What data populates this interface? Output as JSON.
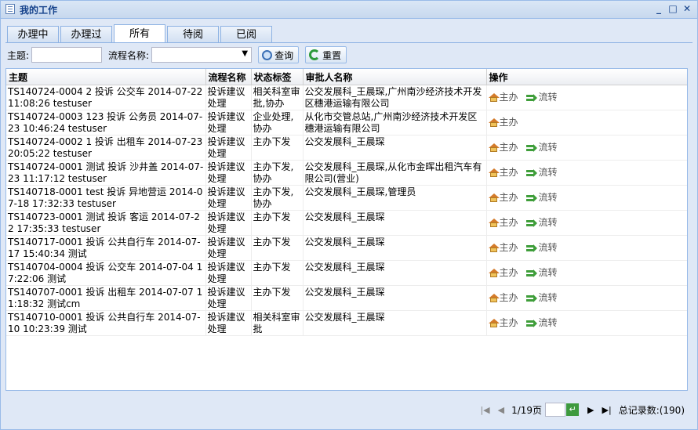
{
  "window": {
    "title": "我的工作"
  },
  "tabs": [
    {
      "label": "办理中",
      "active": false
    },
    {
      "label": "办理过",
      "active": false
    },
    {
      "label": "所有",
      "active": true
    },
    {
      "label": "待阅",
      "active": false
    },
    {
      "label": "已阅",
      "active": false
    }
  ],
  "filter": {
    "subject_label": "主题:",
    "process_label": "流程名称:",
    "query_button": "查询",
    "reset_button": "重置"
  },
  "table": {
    "columns": [
      "主题",
      "流程名称",
      "状态标签",
      "审批人名称",
      "操作"
    ],
    "rows": [
      {
        "subject": "TS140724-0004 2 投诉 公交车 2014-07-22 11:08:26 testuser",
        "process": "投诉建议处理",
        "status": "相关科室审批,协办",
        "approver": "公交发展科_王晨琛,广州南沙经济技术开发区穗港运输有限公司",
        "actions": [
          "主办",
          "流转"
        ]
      },
      {
        "subject": "TS140724-0003 123 投诉 公务员 2014-07-23 10:46:24 testuser",
        "process": "投诉建议处理",
        "status": "企业处理,协办",
        "approver": "从化市交管总站,广州南沙经济技术开发区穗港运输有限公司",
        "actions": [
          "主办"
        ]
      },
      {
        "subject": "TS140724-0002 1 投诉 出租车 2014-07-23 20:05:22 testuser",
        "process": "投诉建议处理",
        "status": "主办下发",
        "approver": "公交发展科_王晨琛",
        "actions": [
          "主办",
          "流转"
        ]
      },
      {
        "subject": "TS140724-0001 测试 投诉 沙井盖 2014-07-23 11:17:12 testuser",
        "process": "投诉建议处理",
        "status": "主办下发,协办",
        "approver": "公交发展科_王晨琛,从化市金晖出租汽车有限公司(营业)",
        "actions": [
          "主办",
          "流转"
        ]
      },
      {
        "subject": "TS140718-0001 test 投诉 异地营运 2014-07-18 17:32:33 testuser",
        "process": "投诉建议处理",
        "status": "主办下发,协办",
        "approver": "公交发展科_王晨琛,管理员",
        "actions": [
          "主办",
          "流转"
        ]
      },
      {
        "subject": "TS140723-0001 测试 投诉 客运 2014-07-22 17:35:33 testuser",
        "process": "投诉建议处理",
        "status": "主办下发",
        "approver": "公交发展科_王晨琛",
        "actions": [
          "主办",
          "流转"
        ]
      },
      {
        "subject": "TS140717-0001 投诉 公共自行车 2014-07-17 15:40:34 测试",
        "process": "投诉建议处理",
        "status": "主办下发",
        "approver": "公交发展科_王晨琛",
        "actions": [
          "主办",
          "流转"
        ]
      },
      {
        "subject": "TS140704-0004 投诉 公交车 2014-07-04 17:22:06 测试",
        "process": "投诉建议处理",
        "status": "主办下发",
        "approver": "公交发展科_王晨琛",
        "actions": [
          "主办",
          "流转"
        ]
      },
      {
        "subject": "TS140707-0001 投诉 出租车 2014-07-07 11:18:32 测试cm",
        "process": "投诉建议处理",
        "status": "主办下发",
        "approver": "公交发展科_王晨琛",
        "actions": [
          "主办",
          "流转"
        ]
      },
      {
        "subject": "TS140710-0001 投诉 公共自行车 2014-07-10 10:23:39 测试",
        "process": "投诉建议处理",
        "status": "相关科室审批",
        "approver": "公交发展科_王晨琛",
        "actions": [
          "主办",
          "流转"
        ]
      }
    ]
  },
  "pager": {
    "page_text": "1/19页",
    "total_text": "总记录数:(190)"
  },
  "icons": {
    "title": "window-list-icon",
    "minimize": "minimize-icon",
    "maximize": "maximize-icon",
    "close": "close-icon"
  }
}
